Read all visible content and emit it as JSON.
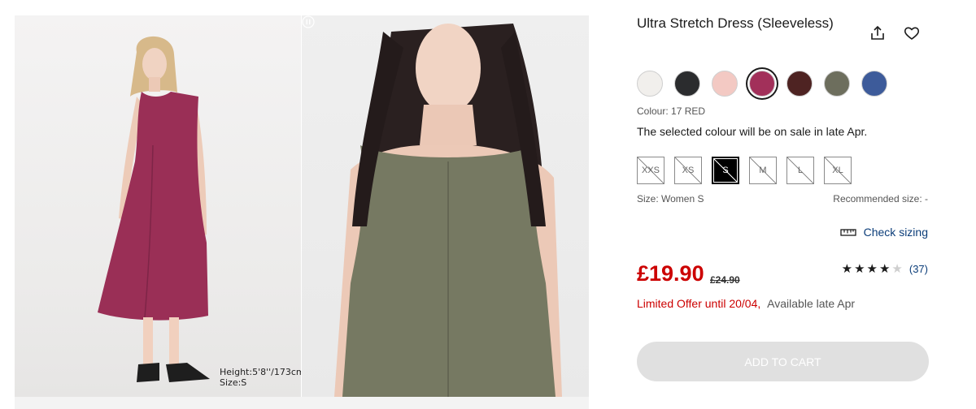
{
  "gallery": {
    "caption_height": "Height:5'8''/173cm",
    "caption_size": "Size:S"
  },
  "product": {
    "title": "Ultra Stretch Dress (Sleeveless)",
    "swatches": [
      {
        "name": "off-white",
        "color": "#f1efec"
      },
      {
        "name": "black",
        "color": "#2b2c2e"
      },
      {
        "name": "pink",
        "color": "#f3c9c3"
      },
      {
        "name": "red",
        "color": "#a2305a",
        "selected": true
      },
      {
        "name": "brown",
        "color": "#4e2322"
      },
      {
        "name": "olive",
        "color": "#6d6e5d"
      },
      {
        "name": "blue",
        "color": "#3d5b9a"
      }
    ],
    "colour_label": "Colour: 17 RED",
    "sale_note": "The selected colour will be on sale in late Apr.",
    "sizes": [
      {
        "label": "XXS",
        "selected": false
      },
      {
        "label": "XS",
        "selected": false
      },
      {
        "label": "S",
        "selected": true
      },
      {
        "label": "M",
        "selected": false
      },
      {
        "label": "L",
        "selected": false
      },
      {
        "label": "XL",
        "selected": false
      }
    ],
    "size_label": "Size: Women S",
    "recommended_size": "Recommended size: -",
    "check_sizing": "Check sizing",
    "price": "£19.90",
    "old_price": "£24.90",
    "rating": {
      "stars": 4,
      "max": 5,
      "count": "(37)"
    },
    "offer": "Limited Offer until 20/04,",
    "availability": "Available late Apr",
    "add_to_cart": "ADD TO CART"
  },
  "colors": {
    "accent_red": "#cc0000",
    "link_blue": "#0b3d79",
    "button_disabled": "#e0e0e0"
  },
  "icons": {
    "share": "share-icon",
    "favorite": "heart-icon",
    "ruler": "ruler-icon",
    "pause": "pause-icon"
  }
}
